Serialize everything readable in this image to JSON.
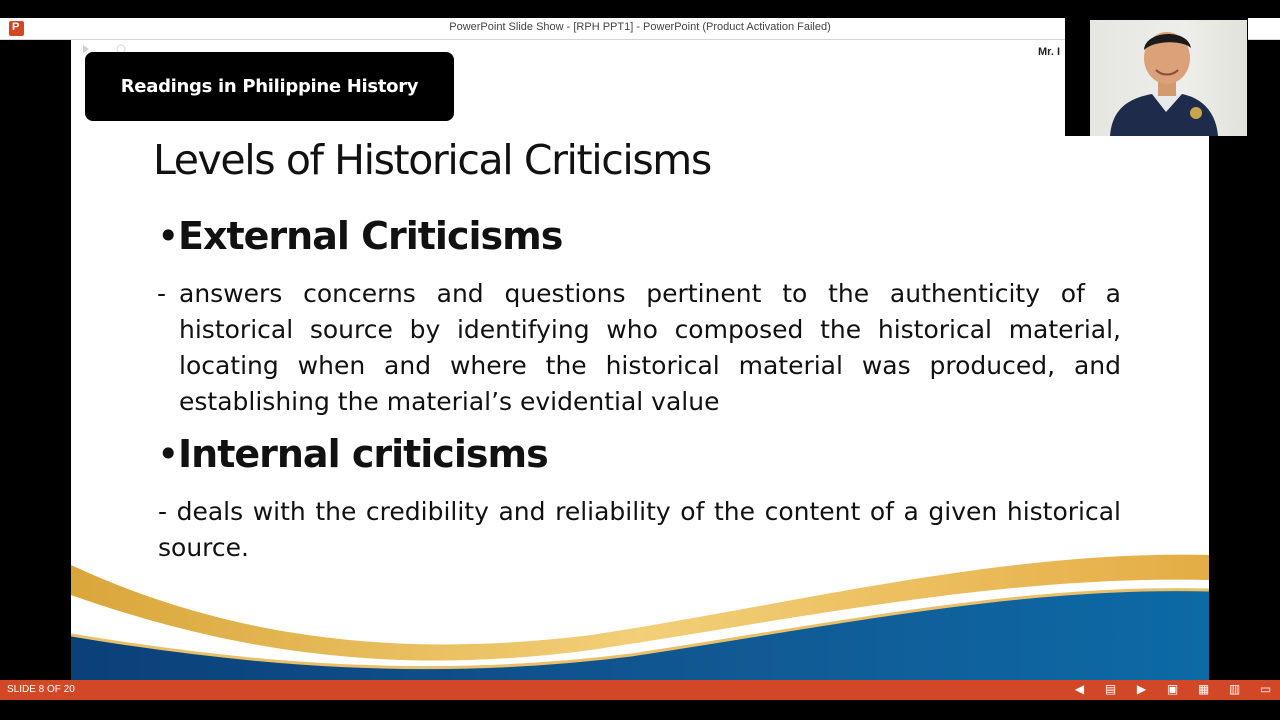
{
  "window": {
    "title": "PowerPoint Slide Show  -  [RPH PPT1]  -  PowerPoint (Product Activation Failed)"
  },
  "slide": {
    "course_banner": "Readings in Philippine History",
    "presenter_tag": "Mr. I",
    "title": "Levels of Historical Criticisms",
    "bullets": [
      {
        "heading": "External Criticisms",
        "body": "answers concerns and questions pertinent to the authenticity of a historical source by identifying who composed the historical material, locating when and where the historical material was produced, and establishing the material’s evidential value"
      },
      {
        "heading": "Internal criticisms",
        "body": "- deals with the credibility and reliability of the content of a given historical source."
      }
    ],
    "bullet_glyph": "•",
    "dash_glyph": "-"
  },
  "statusbar": {
    "slide_counter": "SLIDE 8 OF 20",
    "icons": [
      "previous-icon",
      "slide-list-icon",
      "next-icon",
      "normal-view-icon",
      "slide-sorter-icon",
      "reading-view-icon",
      "slide-show-icon"
    ]
  },
  "colors": {
    "accent": "#d24726",
    "wave_gold": "#e7b24a",
    "wave_blue": "#0f4f86"
  }
}
